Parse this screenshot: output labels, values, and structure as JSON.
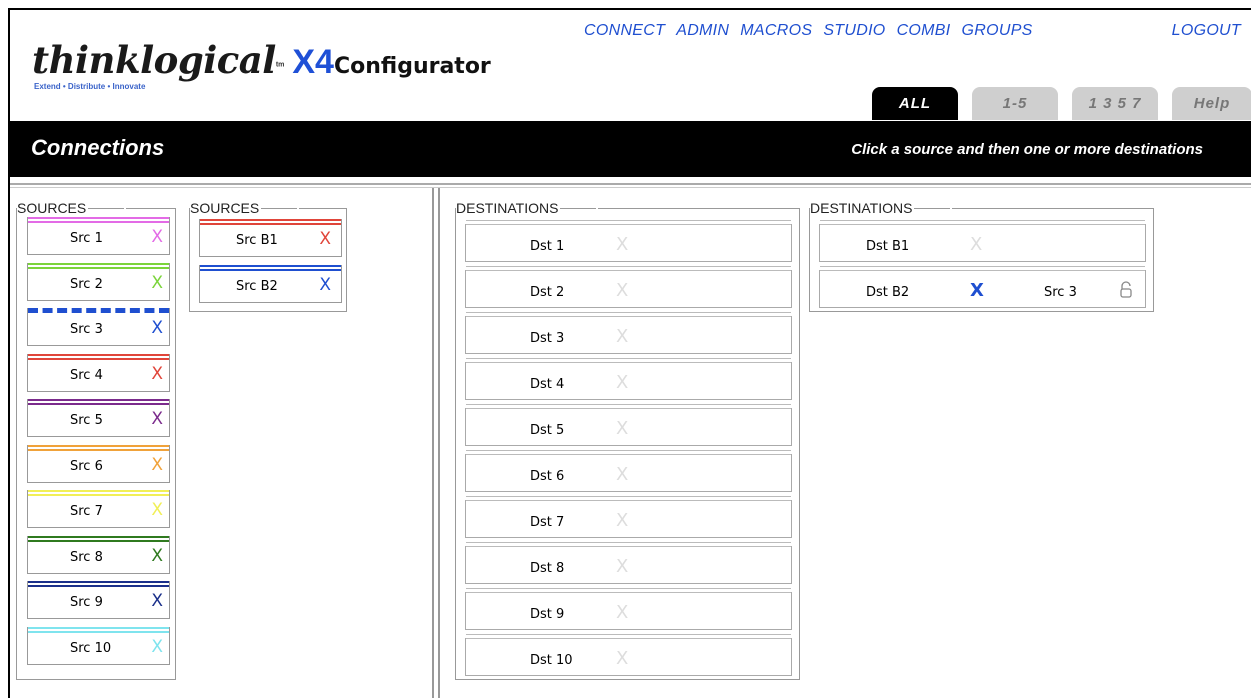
{
  "header": {
    "brand": "thinklogical",
    "product_x4": "X4",
    "product_name": "Configurator",
    "tagline": "Extend • Distribute • Innovate",
    "nav": [
      "CONNECT",
      "ADMIN",
      "MACROS",
      "STUDIO",
      "COMBI",
      "GROUPS"
    ],
    "logout": "LOGOUT"
  },
  "tabs": [
    {
      "label": "ALL",
      "active": true
    },
    {
      "label": "1-5",
      "active": false
    },
    {
      "label": "1 3 5 7",
      "active": false
    },
    {
      "label": "Help",
      "active": false
    }
  ],
  "titlebar": {
    "title": "Connections",
    "hint": "Click a source and then one or more destinations"
  },
  "sources_a": {
    "legend": "SOURCES",
    "items": [
      {
        "label": "Src 1",
        "color": "#e36be6",
        "dashed": false
      },
      {
        "label": "Src 2",
        "color": "#7bd43a",
        "dashed": false
      },
      {
        "label": "Src 3",
        "color": "#1f4fd0",
        "dashed": true
      },
      {
        "label": "Src 4",
        "color": "#e0453a",
        "dashed": false
      },
      {
        "label": "Src 5",
        "color": "#7b2b8c",
        "dashed": false
      },
      {
        "label": "Src 6",
        "color": "#f0a23a",
        "dashed": false
      },
      {
        "label": "Src 7",
        "color": "#f1ef57",
        "dashed": false
      },
      {
        "label": "Src 8",
        "color": "#2f7a1f",
        "dashed": false
      },
      {
        "label": "Src 9",
        "color": "#1a2f8a",
        "dashed": false
      },
      {
        "label": "Src 10",
        "color": "#7fe4ee",
        "dashed": false
      }
    ]
  },
  "sources_b": {
    "legend": "SOURCES",
    "items": [
      {
        "label": "Src B1",
        "color": "#e0453a"
      },
      {
        "label": "Src B2",
        "color": "#1f4fd0"
      }
    ]
  },
  "destinations_a": {
    "legend": "DESTINATIONS",
    "items": [
      "Dst 1",
      "Dst 2",
      "Dst 3",
      "Dst 4",
      "Dst 5",
      "Dst 6",
      "Dst 7",
      "Dst 8",
      "Dst 9",
      "Dst 10"
    ]
  },
  "destinations_b": {
    "legend": "DESTINATIONS",
    "items": [
      {
        "label": "Dst B1",
        "connected": false,
        "source": ""
      },
      {
        "label": "Dst B2",
        "connected": true,
        "source": "Src 3"
      }
    ]
  },
  "x_glyph": "X",
  "icons": {
    "lock": "lock-icon",
    "disconnect": "x-icon"
  }
}
